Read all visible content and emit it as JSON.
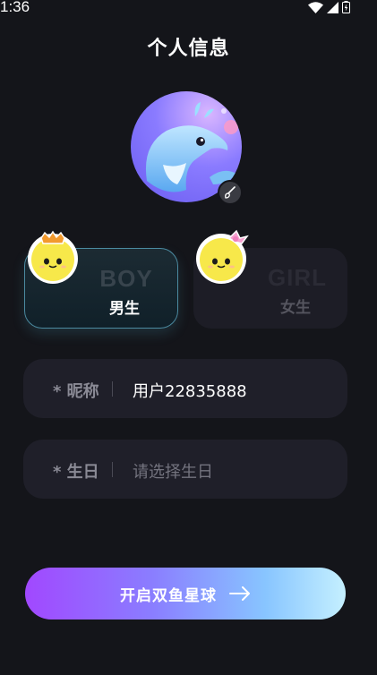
{
  "status_bar": {
    "time": "1:36",
    "icons": [
      "wifi-icon",
      "signal-icon",
      "battery-icon"
    ]
  },
  "header": {
    "title": "个人信息"
  },
  "avatar": {
    "edit_icon": "brush-icon"
  },
  "gender": {
    "boy": {
      "en": "BOY",
      "cn": "男生",
      "selected": true
    },
    "girl": {
      "en": "GIRL",
      "cn": "女生",
      "selected": false
    }
  },
  "form": {
    "nickname": {
      "label": "* 昵称",
      "value": "用户22835888"
    },
    "birthday": {
      "label": "* 生日",
      "placeholder": "请选择生日"
    }
  },
  "start_button": {
    "label": "开启双鱼星球",
    "icon": "arrow-right-icon"
  },
  "colors": {
    "background": "#14151a",
    "field_background": "#1f1f29",
    "accent_start": "#a148ff",
    "accent_end": "#c5f0ff"
  }
}
